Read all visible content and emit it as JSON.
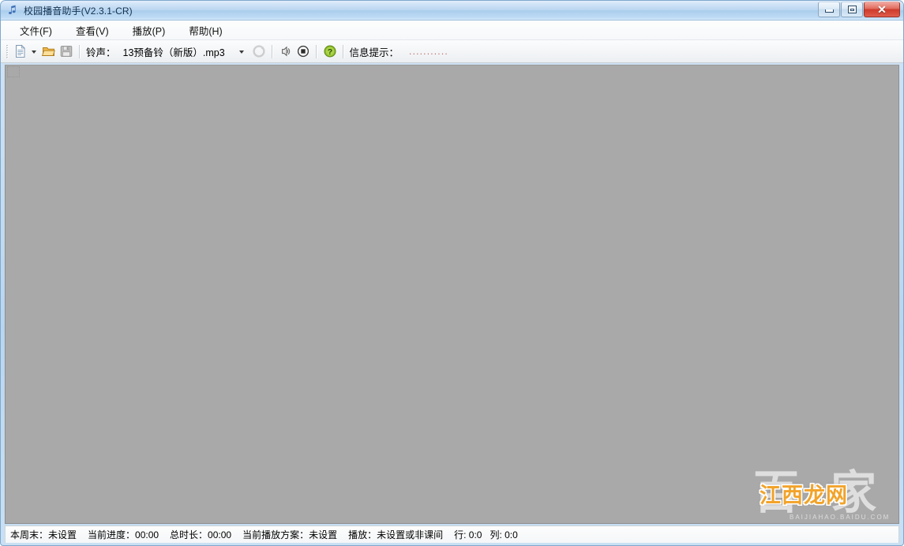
{
  "window": {
    "title": "校园播音助手(V2.3.1-CR)",
    "icon": "music-note-icon",
    "controls": {
      "minimize": "−",
      "maximize": "□",
      "close": "✕"
    }
  },
  "menubar": {
    "items": [
      {
        "label": "文件(F)",
        "name": "menu-file"
      },
      {
        "label": "查看(V)",
        "name": "menu-view"
      },
      {
        "label": "播放(P)",
        "name": "menu-play"
      },
      {
        "label": "帮助(H)",
        "name": "menu-help"
      }
    ]
  },
  "toolbar": {
    "new_icon": "new-document-icon",
    "open_icon": "open-folder-icon",
    "save_icon": "save-disk-icon",
    "ringtone_label": "铃声：",
    "ringtone_value": "13预备铃（新版）.mp3",
    "refresh_icon": "refresh-circle-icon",
    "play_icon": "play-sound-icon",
    "stop_icon": "stop-button-icon",
    "help_icon": "help-question-icon",
    "info_label": "信息提示：",
    "info_value": "..........."
  },
  "content": {
    "background_color": "#a9a9a9"
  },
  "watermark": {
    "logo_text": "百 家",
    "sub_text": "BAIJIAHAO.BAIDU.COM",
    "main_text": "江西龙网",
    "accent_color": "#f2a32a"
  },
  "statusbar": {
    "items": [
      {
        "label": "本周末：未设置",
        "name": "status-weekend"
      },
      {
        "label": "当前进度：00:00",
        "name": "status-progress"
      },
      {
        "label": "总时长：00:00",
        "name": "status-duration"
      },
      {
        "label": "当前播放方案：未设置",
        "name": "status-scheme"
      },
      {
        "label": "播放：未设置或非课间",
        "name": "status-playstate"
      },
      {
        "label": "行:  0:0",
        "name": "status-row"
      },
      {
        "label": "列:  0:0",
        "name": "status-col"
      }
    ]
  }
}
